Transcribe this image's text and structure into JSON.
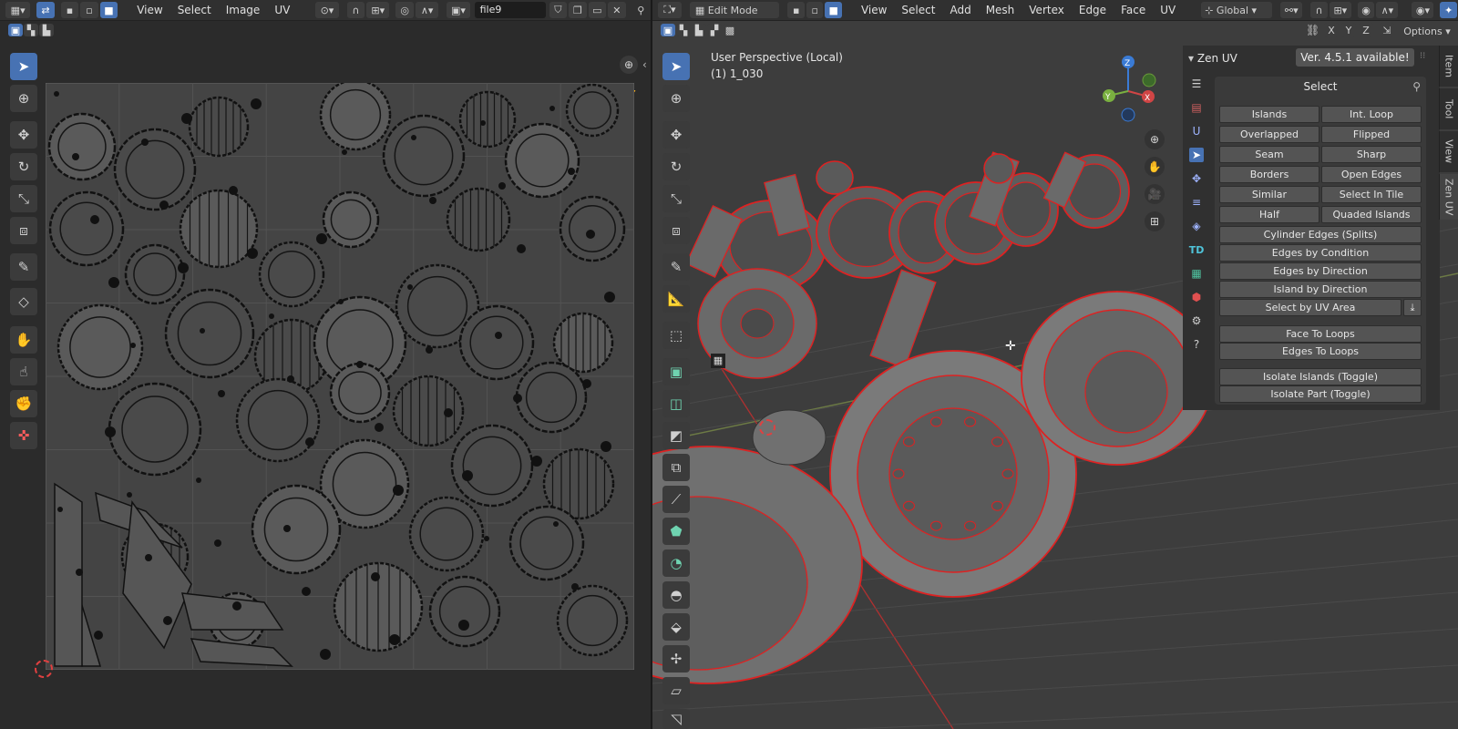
{
  "uv_editor": {
    "menus": [
      "View",
      "Select",
      "Image",
      "UV"
    ],
    "image_name": "file9"
  },
  "viewport": {
    "mode": "Edit Mode",
    "menus": [
      "View",
      "Select",
      "Add",
      "Mesh",
      "Vertex",
      "Edge",
      "Face",
      "UV"
    ],
    "transform_orientation": "Global",
    "axis_x": "X",
    "axis_y": "Y",
    "axis_z": "Z",
    "options_label": "Options",
    "overlay_title": "User Perspective (Local)",
    "overlay_object": "(1) 1_030",
    "gizmo": {
      "x": "X",
      "y": "Y",
      "z": "Z"
    }
  },
  "zen_uv": {
    "title": "Zen UV",
    "version_notice": "Ver. 4.5.1 available!",
    "select_header": "Select",
    "buttons_pairs": [
      [
        "Islands",
        "Int. Loop"
      ],
      [
        "Overlapped",
        "Flipped"
      ],
      [
        "Seam",
        "Sharp"
      ],
      [
        "Borders",
        "Open Edges"
      ],
      [
        "Similar",
        "Select In Tile"
      ],
      [
        "Half",
        "Quaded Islands"
      ]
    ],
    "buttons_full": [
      "Cylinder Edges (Splits)",
      "Edges by Condition",
      "Edges by Direction",
      "Island by Direction"
    ],
    "select_uv_area": "Select by UV Area",
    "loops": [
      "Face To Loops",
      "Edges To Loops"
    ],
    "isolate": [
      "Isolate Islands (Toggle)",
      "Isolate Part (Toggle)"
    ],
    "td_label": "TD"
  },
  "side_tabs": [
    "Item",
    "Tool",
    "View",
    "Zen UV"
  ]
}
